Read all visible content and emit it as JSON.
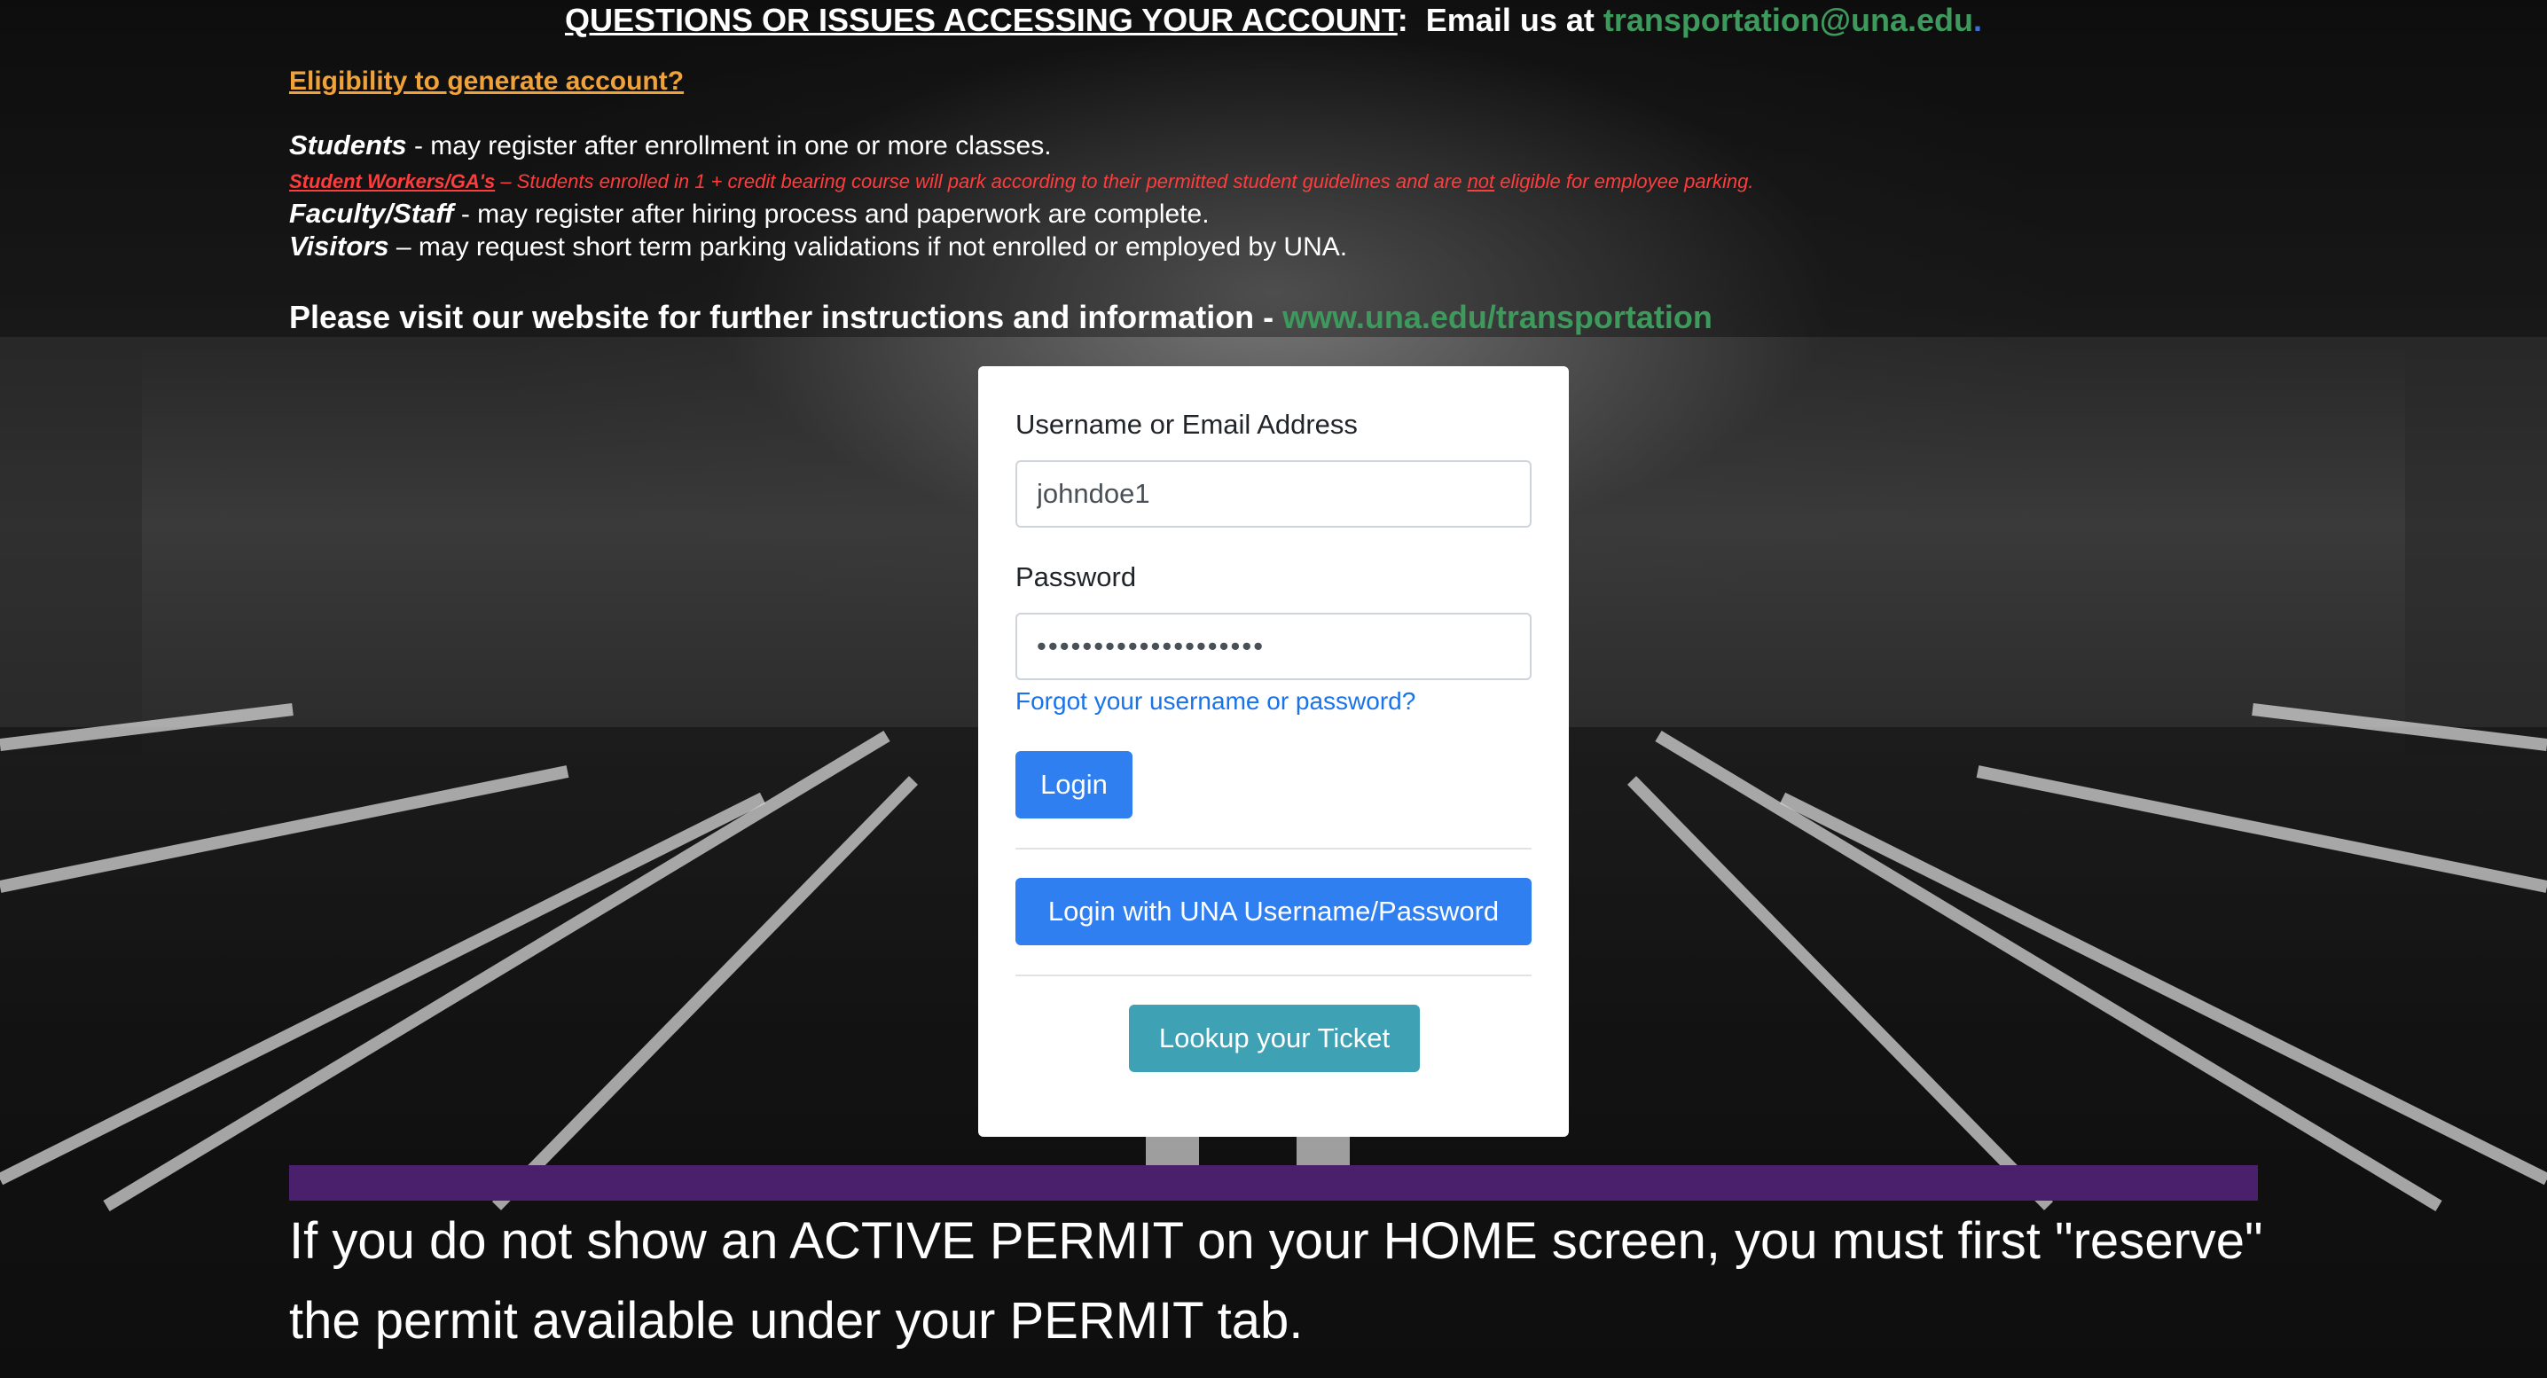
{
  "header": {
    "questions_text": "QUESTIONS OR ISSUES ACCESSING YOUR ACCOUNT",
    "colon": ":",
    "email_prefix": "Email us at",
    "email": "transportation@una.edu",
    "email_dot": "."
  },
  "eligibility": {
    "heading": "Eligibility to generate account?",
    "students_label": "Students",
    "students_text": " - may register after enrollment in one or more classes.",
    "workers_label": "Student Workers/GA's",
    "workers_text_1": " – Students enrolled in 1 + credit bearing course will park according to their permitted student guidelines and are ",
    "workers_not": "not",
    "workers_text_2": " eligible for employee parking.",
    "faculty_label": "Faculty/Staff",
    "faculty_text": " - may register after hiring process and paperwork are complete.",
    "visitors_label": "Visitors",
    "visitors_text": " – may request short term parking validations if not enrolled or employed by UNA."
  },
  "visit": {
    "text": "Please visit our website for further instructions and information - ",
    "link": "www.una.edu/transportation"
  },
  "login": {
    "username_label": "Username or Email Address",
    "username_value": "johndoe1",
    "password_label": "Password",
    "password_value": "••••••••••••••••••••",
    "forgot_link": "Forgot your username or password?",
    "login_button": "Login",
    "una_button": "Login with UNA Username/Password",
    "ticket_button": "Lookup your Ticket"
  },
  "notice": {
    "text": "If you do not show an ACTIVE PERMIT on your HOME screen, you must first \"reserve\" the permit available under your PERMIT tab."
  },
  "colors": {
    "accent_blue": "#2f7ff0",
    "teal": "#3fa1b4",
    "link_green": "#3d9a5c",
    "eligibility_orange": "#f0a23a",
    "warning_red": "#ff3c3c",
    "purple_bar": "#4a1f6b"
  }
}
